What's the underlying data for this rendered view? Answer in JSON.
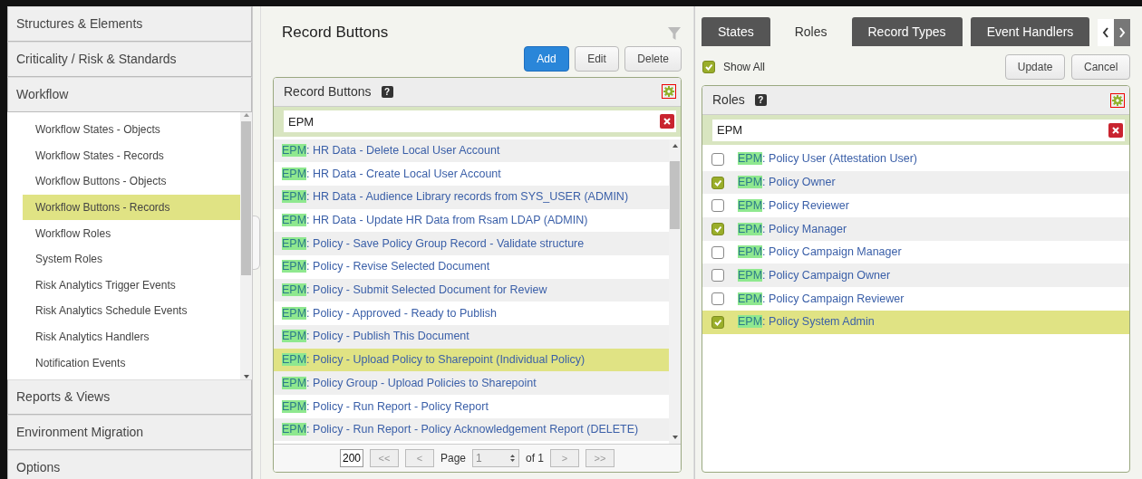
{
  "sidebar": {
    "sections": [
      {
        "label": "Structures & Elements"
      },
      {
        "label": "Criticality / Risk & Standards"
      },
      {
        "label": "Workflow",
        "items": [
          {
            "label": "Workflow States - Objects",
            "selected": false
          },
          {
            "label": "Workflow States - Records",
            "selected": false
          },
          {
            "label": "Workflow Buttons - Objects",
            "selected": false
          },
          {
            "label": "Workflow Buttons - Records",
            "selected": true
          },
          {
            "label": "Workflow Roles",
            "selected": false
          },
          {
            "label": "System Roles",
            "selected": false
          },
          {
            "label": "Risk Analytics Trigger Events",
            "selected": false
          },
          {
            "label": "Risk Analytics Schedule Events",
            "selected": false
          },
          {
            "label": "Risk Analytics Handlers",
            "selected": false
          },
          {
            "label": "Notification Events",
            "selected": false
          }
        ]
      },
      {
        "label": "Reports & Views"
      },
      {
        "label": "Environment Migration"
      },
      {
        "label": "Options"
      }
    ]
  },
  "middle": {
    "title": "Record Buttons",
    "buttons": [
      {
        "label": "Add",
        "kind": "primary"
      },
      {
        "label": "Edit",
        "kind": "default"
      },
      {
        "label": "Delete",
        "kind": "default"
      }
    ],
    "panel": {
      "title": "Record Buttons",
      "help": "?",
      "search": "EPM",
      "rows": [
        {
          "prefix": "EPM",
          "text": ": HR Data - Delete Local User Account",
          "selected": false
        },
        {
          "prefix": "EPM",
          "text": ": HR Data - Create Local User Account",
          "selected": false
        },
        {
          "prefix": "EPM",
          "text": ": HR Data - Audience Library records from SYS_USER (ADMIN)",
          "selected": false
        },
        {
          "prefix": "EPM",
          "text": ": HR Data - Update HR Data from Rsam LDAP (ADMIN)",
          "selected": false
        },
        {
          "prefix": "EPM",
          "text": ": Policy - Save Policy Group Record - Validate structure",
          "selected": false
        },
        {
          "prefix": "EPM",
          "text": ": Policy - Revise Selected Document",
          "selected": false
        },
        {
          "prefix": "EPM",
          "text": ": Policy - Submit Selected Document for Review",
          "selected": false
        },
        {
          "prefix": "EPM",
          "text": ": Policy - Approved - Ready to Publish",
          "selected": false
        },
        {
          "prefix": "EPM",
          "text": ": Policy - Publish This Document",
          "selected": false
        },
        {
          "prefix": "EPM",
          "text": ": Policy - Upload Policy to Sharepoint (Individual Policy)",
          "selected": true
        },
        {
          "prefix": "EPM",
          "text": ": Policy Group - Upload Policies to Sharepoint",
          "selected": false
        },
        {
          "prefix": "EPM",
          "text": ": Policy - Run Report - Policy Report",
          "selected": false
        },
        {
          "prefix": "EPM",
          "text": ": Policy - Run Report - Policy Acknowledgement Report (DELETE)",
          "selected": false
        }
      ],
      "pager": {
        "page_size": "200",
        "first": "<<",
        "prev": "<",
        "page_label": "Page",
        "page": "1",
        "of": "of 1",
        "next": ">",
        "last": ">>"
      }
    }
  },
  "right": {
    "tabs": [
      {
        "label": "States",
        "selected": false
      },
      {
        "label": "Roles",
        "selected": true
      },
      {
        "label": "Record Types",
        "selected": false
      },
      {
        "label": "Event Handlers",
        "selected": false
      }
    ],
    "show_all": {
      "label": "Show All",
      "checked": true
    },
    "buttons": [
      {
        "label": "Update"
      },
      {
        "label": "Cancel"
      }
    ],
    "panel": {
      "title": "Roles",
      "help": "?",
      "search": "EPM",
      "rows": [
        {
          "prefix": "EPM",
          "text": ": Policy User (Attestation User)",
          "checked": false,
          "selected": false
        },
        {
          "prefix": "EPM",
          "text": ": Policy Owner",
          "checked": true,
          "selected": false
        },
        {
          "prefix": "EPM",
          "text": ": Policy Reviewer",
          "checked": false,
          "selected": false
        },
        {
          "prefix": "EPM",
          "text": ": Policy Manager",
          "checked": true,
          "selected": false
        },
        {
          "prefix": "EPM",
          "text": ": Policy Campaign Manager",
          "checked": false,
          "selected": false
        },
        {
          "prefix": "EPM",
          "text": ": Policy Campaign Owner",
          "checked": false,
          "selected": false
        },
        {
          "prefix": "EPM",
          "text": ": Policy Campaign Reviewer",
          "checked": false,
          "selected": false
        },
        {
          "prefix": "EPM",
          "text": ": Policy System Admin",
          "checked": true,
          "selected": true
        }
      ]
    }
  }
}
